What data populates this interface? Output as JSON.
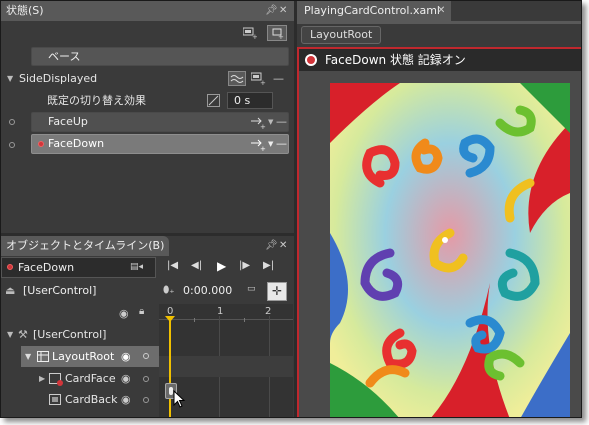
{
  "states_panel": {
    "title": "状態(S)",
    "base_state": "ベース",
    "group_name": "SideDisplayed",
    "transition_label": "既定の切り替え効果",
    "transition_value": "0 s",
    "states": [
      "FaceUp",
      "FaceDown"
    ]
  },
  "objects_panel": {
    "title": "オブジェクトとタイムライン(B)",
    "storyboard": "FaceDown",
    "scope": "[UserControl]",
    "time": "0:00.000",
    "ruler_ticks": [
      "0",
      "1",
      "2"
    ],
    "tree": {
      "root": "[UserControl]",
      "layout_root": "LayoutRoot",
      "children": [
        "CardFace",
        "CardBack"
      ]
    }
  },
  "document": {
    "tab_title": "PlayingCardControl.xaml",
    "breadcrumb": "LayoutRoot",
    "recording_banner": "FaceDown 状態 記録オン"
  },
  "colors": {
    "panel_bg": "#3a3a3a",
    "header_bg": "#595959",
    "record_red": "#d2353a",
    "timeline_needle": "#f0c000",
    "artboard_bg": "#4a4a4a"
  },
  "icons": {
    "pin": "pin-icon",
    "close": "close-icon",
    "record": "record-icon",
    "eye": "eye-icon",
    "lock": "lock-icon"
  }
}
